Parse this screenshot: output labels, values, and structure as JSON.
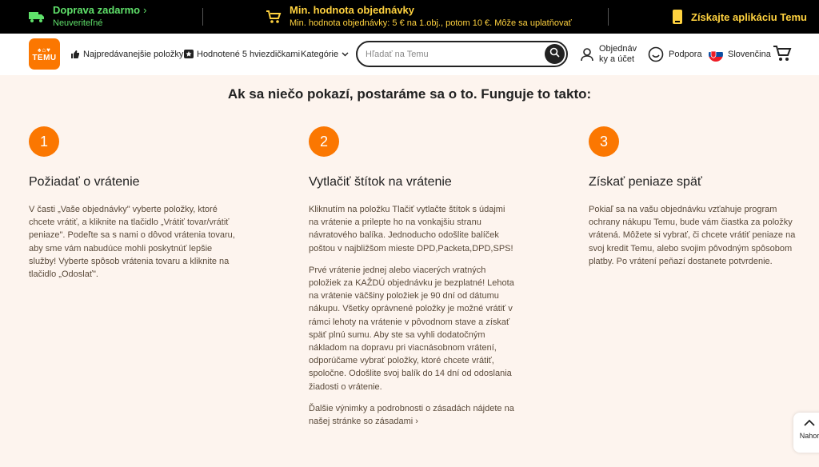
{
  "promo": {
    "free_title": "Doprava zadarmo",
    "free_sub": "Neuveriteľné",
    "min_title": "Min. hodnota objednávky",
    "min_sub": "Min. hodnota objednávky: 5 € na 1.obj., potom 10 €. Môže sa uplatňovať",
    "app_title": "Získajte aplikáciu Temu"
  },
  "header": {
    "logo_text": "TEMU",
    "nav_best": "Najpredávanejšie položky",
    "nav_rated": "Hodnotené 5 hviezdičkami",
    "nav_categories": "Kategórie",
    "search_placeholder": "Hľadať na Temu",
    "account_line1": "Objednáv",
    "account_line2": "ky a účet",
    "support": "Podpora",
    "language": "Slovenčina"
  },
  "main": {
    "heading": "Ak sa niečo pokazí, postaráme sa o to. Funguje to takto:",
    "steps": [
      {
        "number": "1",
        "title": "Požiadať o vrátenie",
        "body": "V časti „Vaše objednávky\" vyberte položky, ktoré chcete vrátiť, a kliknite na tlačidlo „Vrátiť tovar/vrátiť peniaze\". Podeľte sa s nami o dôvod vrátenia tovaru, aby sme vám nabudúce mohli poskytnúť lepšie služby! Vyberte spôsob vrátenia tovaru a kliknite na tlačidlo „Odoslať\"."
      },
      {
        "number": "2",
        "title": "Vytlačiť štítok na vrátenie",
        "body": "Kliknutím na položku Tlačiť vytlačte štítok s údajmi na vrátenie a prilepte ho na vonkajšiu stranu návratového balíka. Jednoducho odošlite balíček poštou v najbližšom mieste DPD,Packeta,DPD,SPS!",
        "body2": "Prvé vrátenie jednej alebo viacerých vratných položiek za KAŽDÚ objednávku je bezplatné! Lehota na vrátenie väčšiny položiek je 90 dní od dátumu nákupu. Všetky oprávnené položky je možné vrátiť v rámci lehoty na vrátenie v pôvodnom stave a získať späť plnú sumu. Aby ste sa vyhli dodatočným nákladom na dopravu pri viacnásobnom vrátení, odporúčame vybrať položky, ktoré chcete vrátiť, spoločne. Odošlite svoj balík do 14 dní od odoslania žiadosti o vrátenie.",
        "body3": "Ďalšie výnimky a podrobnosti o zásadách nájdete na našej stránke so zásadami"
      },
      {
        "number": "3",
        "title": "Získať peniaze späť",
        "body": "Pokiaľ sa na vašu objednávku vzťahuje program ochrany nákupu Temu, bude vám čiastka za položky vrátená. Môžete si vybrať, či chcete vrátiť peniaze na svoj kredit Temu, alebo svojim pôvodným spôsobom platby. Po vrátení peňazí dostanete potvrdenie."
      }
    ]
  },
  "scroll_top_label": "Nahor",
  "colors": {
    "accent": "#fb7701",
    "promo_green": "#5fe06a",
    "promo_yellow": "#ffd23f"
  }
}
